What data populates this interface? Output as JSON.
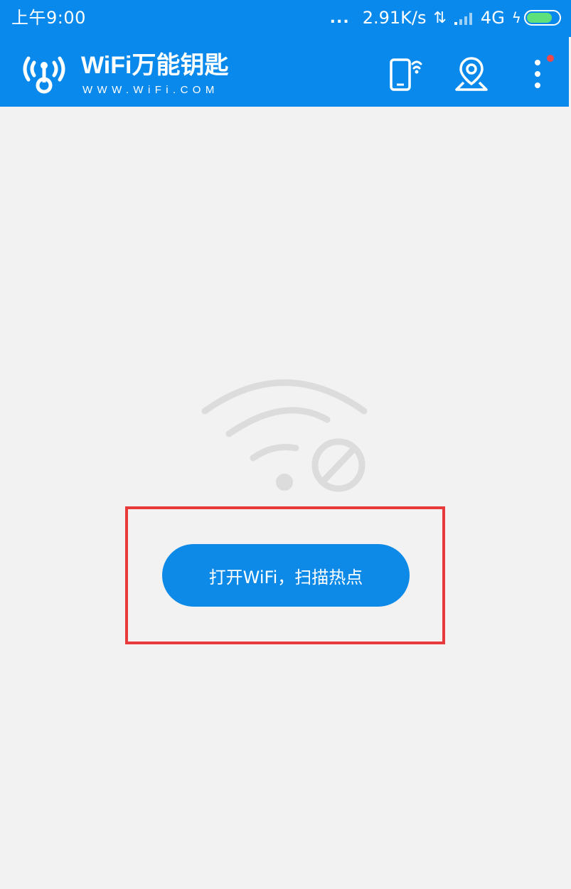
{
  "status_bar": {
    "time": "上午9:00",
    "dots": "...",
    "speed": "2.91K/s",
    "arrows": "⇅",
    "network": "4G",
    "bolt": "ϟ",
    "battery_level": 0.8
  },
  "app_bar": {
    "logo_title": "WiFi万能钥匙",
    "logo_subtitle": "WWW.WiFi.COM",
    "icons": [
      "phone-signal-icon",
      "map-location-icon",
      "more-vertical-icon"
    ],
    "notification_dot_color": "#f04848"
  },
  "main": {
    "icon": "wifi-disabled-icon",
    "open_wifi_button_label": "打开WiFi，扫描热点",
    "highlight_color": "#e83a3a"
  },
  "colors": {
    "brand_blue": "#0a89ec",
    "button_blue": "#0d8ae8",
    "background": "#f2f2f2",
    "icon_gray": "#dcdcdc"
  }
}
